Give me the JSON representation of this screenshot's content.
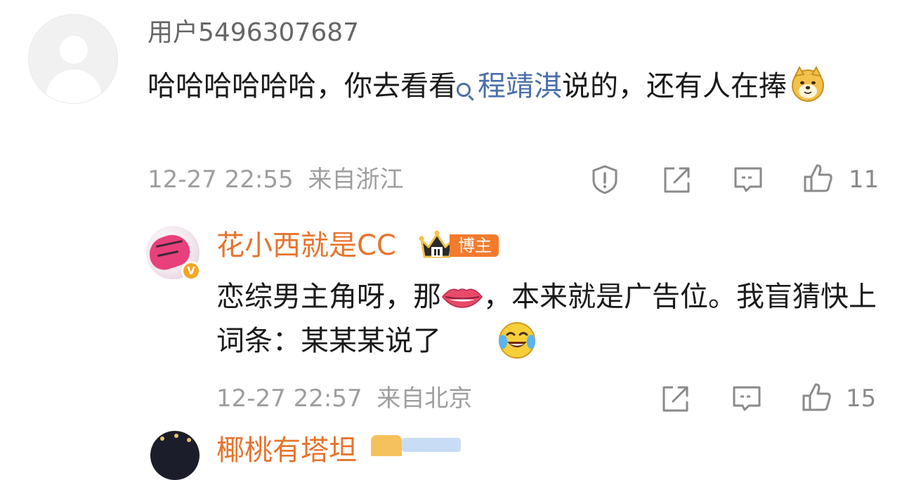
{
  "comment1": {
    "username": "用户5496307687",
    "text_before": "哈哈哈哈哈哈，你去看看",
    "mention": "程靖淇",
    "text_after": "说的，还有人在捧",
    "emoji": "doge-emoji",
    "time": "12-27 22:55",
    "location": "来自浙江",
    "like_count": "11",
    "icons": [
      "report-icon",
      "repost-icon",
      "reply-icon",
      "like-icon"
    ]
  },
  "comment2": {
    "username": "花小西就是CC",
    "badge_label": "博主",
    "text_line1": "恋综男主角呀，那",
    "text_line2": "，本来就是广告位。我盲猜快上词条：某某某说了",
    "emojis": [
      "lips-emoji",
      "laugh-cry-emoji"
    ],
    "time": "12-27 22:57",
    "location": "来自北京",
    "like_count": "15",
    "icons": [
      "repost-icon",
      "reply-icon",
      "like-icon"
    ],
    "colors": {
      "name": "#e8732c",
      "badge": "#f37b2c",
      "verified": "#f5a623"
    }
  },
  "comment3": {
    "username_partial": "椰桃有塔坦"
  },
  "colors": {
    "mention": "#4a6fa8",
    "meta": "#9e9e9e",
    "text": "#1a1a1a"
  }
}
